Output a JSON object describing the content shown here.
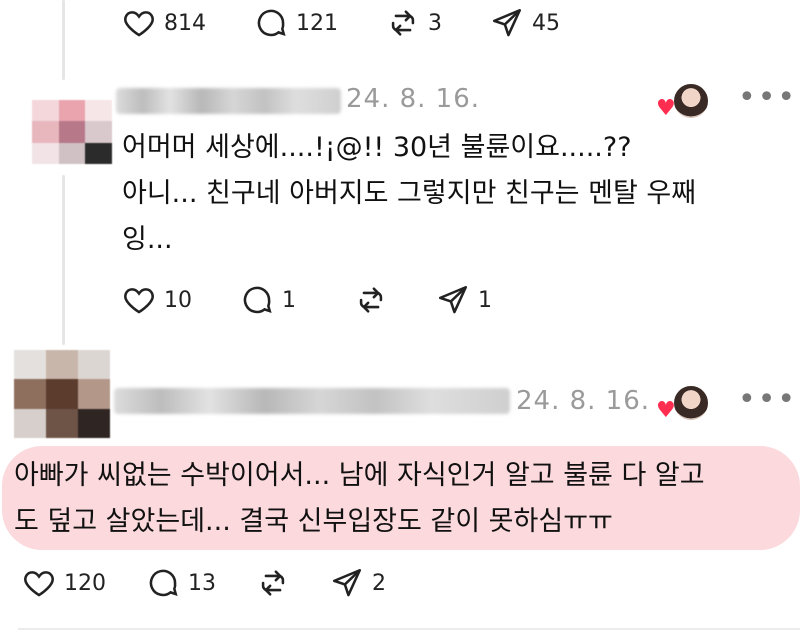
{
  "top_actions": {
    "likes": "814",
    "comments": "121",
    "reposts": "3",
    "shares": "45"
  },
  "reply1": {
    "date": "24. 8. 16.",
    "text_line1": "어머머 세상에....!¡@!! 30년 불륜이요.....??",
    "text_line2": "아니... 친구네 아버지도 그렇지만 친구는 멘탈 우째",
    "text_line3": "잉...",
    "likes": "10",
    "comments": "1",
    "shares": "1"
  },
  "reply2": {
    "date": "24. 8. 16.",
    "text_line1": "아빠가 씨없는 수박이어서... 남에 자식인거 알고 불륜 다 알고",
    "text_line2": "도 덮고 살았는데... 결국 신부입장도 같이 못하심ㅠㅠ",
    "likes": "120",
    "comments": "13",
    "shares": "2"
  },
  "icons": [
    "heart-icon",
    "comment-icon",
    "repost-icon",
    "share-icon",
    "more-icon",
    "reaction-heart-icon"
  ],
  "colors": {
    "highlight": "#fbd9dd",
    "reaction_heart": "#ff2d4f",
    "muted_text": "#9a9a9a"
  }
}
